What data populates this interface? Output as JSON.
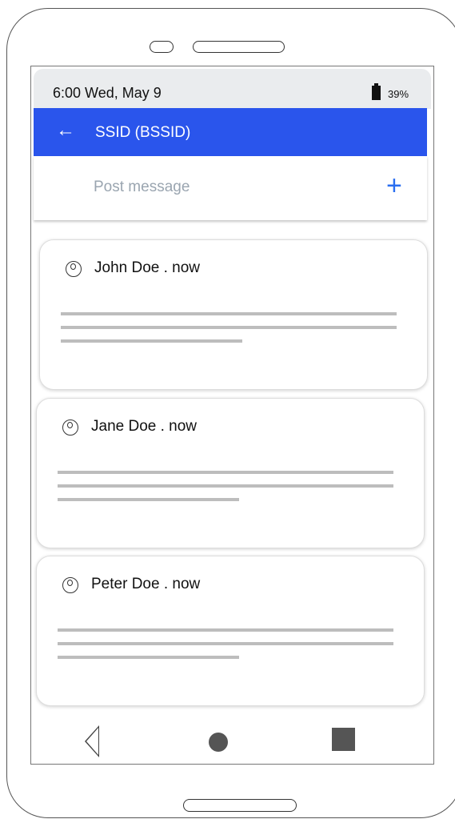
{
  "status_bar": {
    "time_date": "6:00  Wed, May 9",
    "battery": "39%"
  },
  "app_bar": {
    "back_icon": "arrow-left-icon",
    "title": "SSID (BSSID)"
  },
  "composer": {
    "placeholder": "Post message",
    "add_icon": "plus-icon"
  },
  "posts": [
    {
      "author": "John Doe . ",
      "time": "now"
    },
    {
      "author": "Jane Doe . ",
      "time": "now"
    },
    {
      "author": "Peter Doe . ",
      "time": "now"
    }
  ],
  "nav_bar": {
    "back": "nav-back-triangle-icon",
    "home": "nav-home-circle-icon",
    "recents": "nav-recents-square-icon"
  },
  "colors": {
    "app_bar": "#2a55ec",
    "accent": "#2a6ef0",
    "status_bar": "#eaecee"
  }
}
